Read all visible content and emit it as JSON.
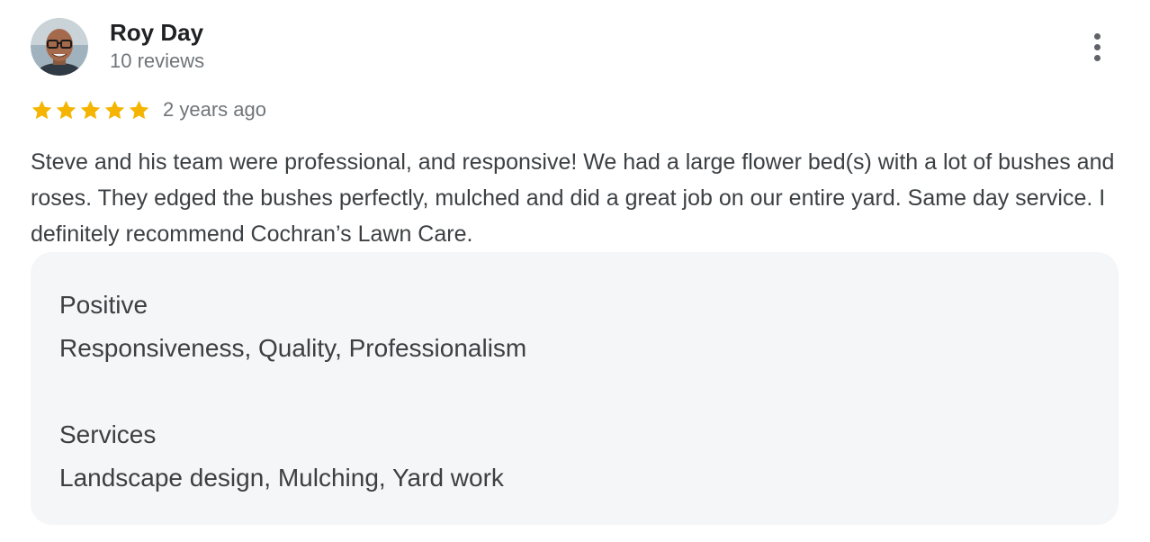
{
  "review": {
    "author_name": "Roy Day",
    "author_meta": "10 reviews",
    "rating": 5,
    "rating_max": 5,
    "star_color": "#f4b400",
    "date": "2 years ago",
    "text": "Steve and his team were professional, and responsive! We had a large flower bed(s) with a lot of bushes and roses. They edged the bushes perfectly, mulched and did a great job on our entire yard. Same day service. I definitely recommend Cochran’s Lawn Care.",
    "more_icon": "more-vert-icon"
  },
  "attributes": [
    {
      "label": "Positive",
      "value": "Responsiveness, Quality, Professionalism"
    },
    {
      "label": "Services",
      "value": "Landscape design, Mulching, Yard work"
    }
  ]
}
